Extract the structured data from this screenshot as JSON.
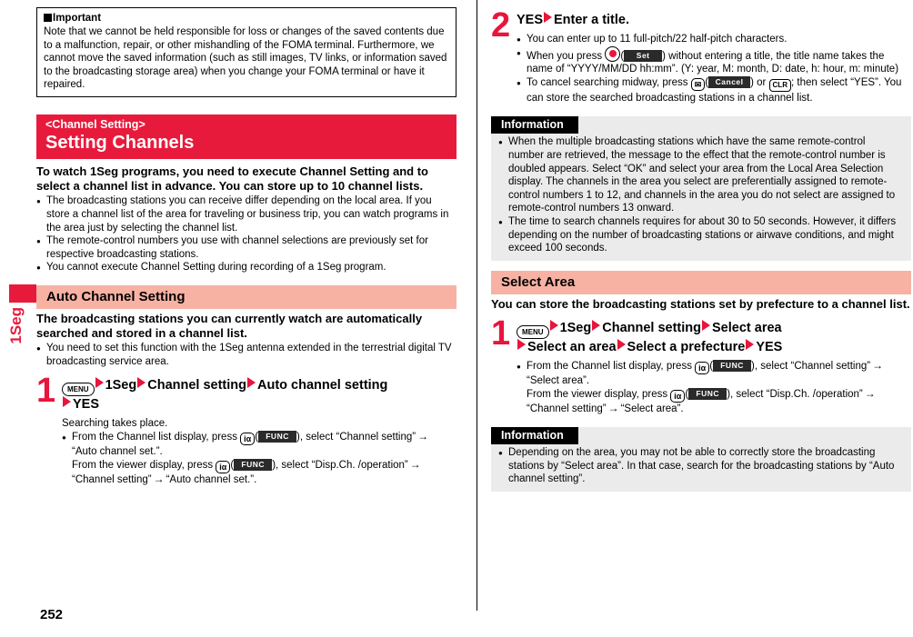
{
  "page": {
    "number": "252",
    "side_tab_label": "1Seg"
  },
  "left_column": {
    "important": {
      "title": "Important",
      "body": "Note that we cannot be held responsible for loss or changes of the saved contents due to a malfunction, repair, or other mishandling of the FOMA terminal. Furthermore, we cannot move the saved information (such as still images, TV links, or information saved to the broadcasting storage area) when you change your FOMA terminal or have it repaired."
    },
    "banner": {
      "subtitle": "<Channel Setting>",
      "title": "Setting Channels"
    },
    "lead": "To watch 1Seg programs, you need to execute Channel Setting and to select a channel list in advance. You can store up to 10 channel lists.",
    "bullets": [
      "The broadcasting stations you can receive differ depending on the local area. If you store a channel list of the area for traveling or business trip, you can watch programs in the area just by selecting the channel list.",
      "The remote-control numbers you use with channel selections are previously set for respective broadcasting stations.",
      "You cannot execute Channel Setting during recording of a 1Seg program."
    ],
    "section": {
      "heading": "Auto Channel Setting",
      "lead": "The broadcasting stations you can currently watch are automatically searched and stored in a channel list.",
      "bullets": [
        "You need to set this function with the 1Seg antenna extended in the terrestrial digital TV broadcasting service area."
      ]
    },
    "step1": {
      "number": "1",
      "key_menu": "MENU",
      "head_part1": "1Seg",
      "head_part2": "Channel setting",
      "head_part3": "Auto channel setting",
      "head_part4": "YES",
      "body_line1": "Searching takes place.",
      "bullet_line1_a": "From the Channel list display, press",
      "key_ifunc": "iα",
      "softkey_func": "FUNC",
      "bullet_line1_b": "), select “Channel setting”",
      "bullet_line1_c": "“Auto channel set.”.",
      "bullet_line2_a": "From the viewer display, press",
      "bullet_line2_b": "), select “Disp.Ch. /operation”",
      "bullet_line2_c": "“Channel setting”",
      "bullet_line2_d": "“Auto channel set.”."
    }
  },
  "right_column": {
    "step2": {
      "number": "2",
      "head_part1": "YES",
      "head_part2": "Enter a title.",
      "bullets": [
        "You can enter up to 11 full-pitch/22 half-pitch characters.",
        "When you press",
        "To cancel searching midway, press"
      ],
      "b2_softkey": "Set",
      "b2_rest": ") without entering a title, the title name takes the name of “YYYY/MM/DD hh:mm”. (Y: year, M: month, D: date, h: hour, m: minute)",
      "b3_key_mail": "✉",
      "b3_softkey": "Cancel",
      "b3_mid": ") or",
      "b3_key_clr": "CLR",
      "b3_rest": "; then select “YES”. You can store the searched broadcasting stations in a channel list."
    },
    "info1": {
      "title": "Information",
      "bullets": [
        "When the multiple broadcasting stations which have the same remote-control number are retrieved, the message to the effect that the remote-control number is doubled appears. Select “OK” and select your area from the Local Area Selection display. The channels in the area you select are preferentially assigned to remote-control numbers 1 to 12, and channels in the area you do not select are assigned to remote-control numbers 13 onward.",
        "The time to search channels requires for about 30 to 50 seconds. However, it differs depending on the number of broadcasting stations or airwave conditions, and might exceed 100 seconds."
      ]
    },
    "section": {
      "heading": "Select Area",
      "lead": "You can store the broadcasting stations set by prefecture to a channel list."
    },
    "step1": {
      "number": "1",
      "key_menu": "MENU",
      "head_part1": "1Seg",
      "head_part2": "Channel setting",
      "head_part3": "Select area",
      "head_part4": "Select an area",
      "head_part5": "Select a prefecture",
      "head_part6": "YES",
      "bullet_line1_a": "From the Channel list display, press",
      "key_ifunc": "iα",
      "softkey_func": "FUNC",
      "bullet_line1_b": "), select “Channel setting”",
      "bullet_line1_c": "“Select area”.",
      "bullet_line2_a": "From the viewer display, press",
      "bullet_line2_b": "), select “Disp.Ch. /operation”",
      "bullet_line2_c": "“Channel setting”",
      "bullet_line2_d": "“Select area”."
    },
    "info2": {
      "title": "Information",
      "bullets": [
        "Depending on the area, you may not be able to correctly store the broadcasting stations by “Select area”. In that case, search for the broadcasting stations by “Auto channel setting”."
      ]
    }
  },
  "colors": {
    "accent_red": "#e8153c",
    "pink_heading": "#f7b2a4",
    "info_bg": "#ebebeb",
    "info_title_bg": "#000000"
  }
}
